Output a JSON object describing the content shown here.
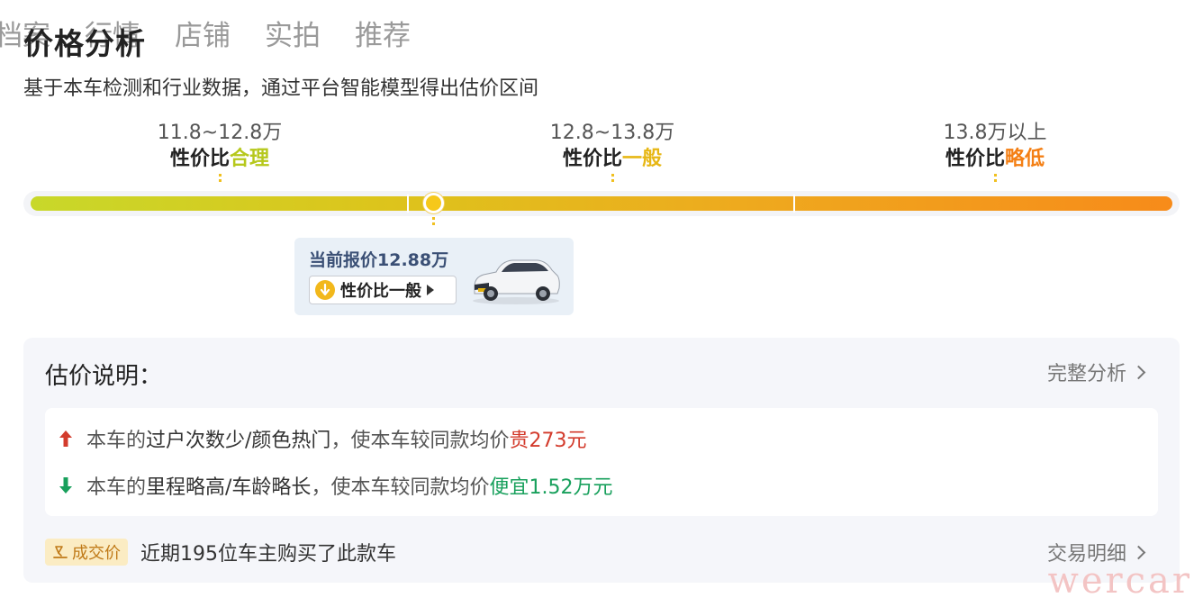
{
  "tabs": [
    "档案",
    "行情",
    "店铺",
    "实拍",
    "推荐"
  ],
  "header": {
    "title": "价格分析",
    "subtitle": "基于本车检测和行业数据，通过平台智能模型得出估价区间"
  },
  "segments": [
    {
      "range": "11.8~12.8万",
      "verdict_prefix": "性价比",
      "verdict": "合理",
      "color": "#b6c81c"
    },
    {
      "range": "12.8~13.8万",
      "verdict_prefix": "性价比",
      "verdict": "一般",
      "color": "#e7b715"
    },
    {
      "range": "13.8万以上",
      "verdict_prefix": "性价比",
      "verdict": "略低",
      "color": "#f47f14"
    }
  ],
  "current": {
    "quote": "当前报价12.88万",
    "verdict_chip": "性价比一般",
    "chip_icon": "down-arrow-circle-icon"
  },
  "explanation": {
    "title": "估价说明：",
    "link": "完整分析",
    "reasons": [
      {
        "direction": "up",
        "pre": "本车的",
        "key": "过户次数少/颜色热门",
        "mid": "，使本车较同款均价",
        "effect": "贵273元"
      },
      {
        "direction": "down",
        "pre": "本车的",
        "key": "里程略高/车龄略长",
        "mid": "，使本车较同款均价",
        "effect": "便宜1.52万元"
      }
    ]
  },
  "deal": {
    "badge": "成交价",
    "text": "近期195位车主购买了此款车",
    "link": "交易明细"
  },
  "colors": {
    "up": "#d33b2c",
    "down": "#18a05c",
    "marker": "#f6c81a",
    "card_bg": "#e9f0f7"
  },
  "watermark": "wercar"
}
